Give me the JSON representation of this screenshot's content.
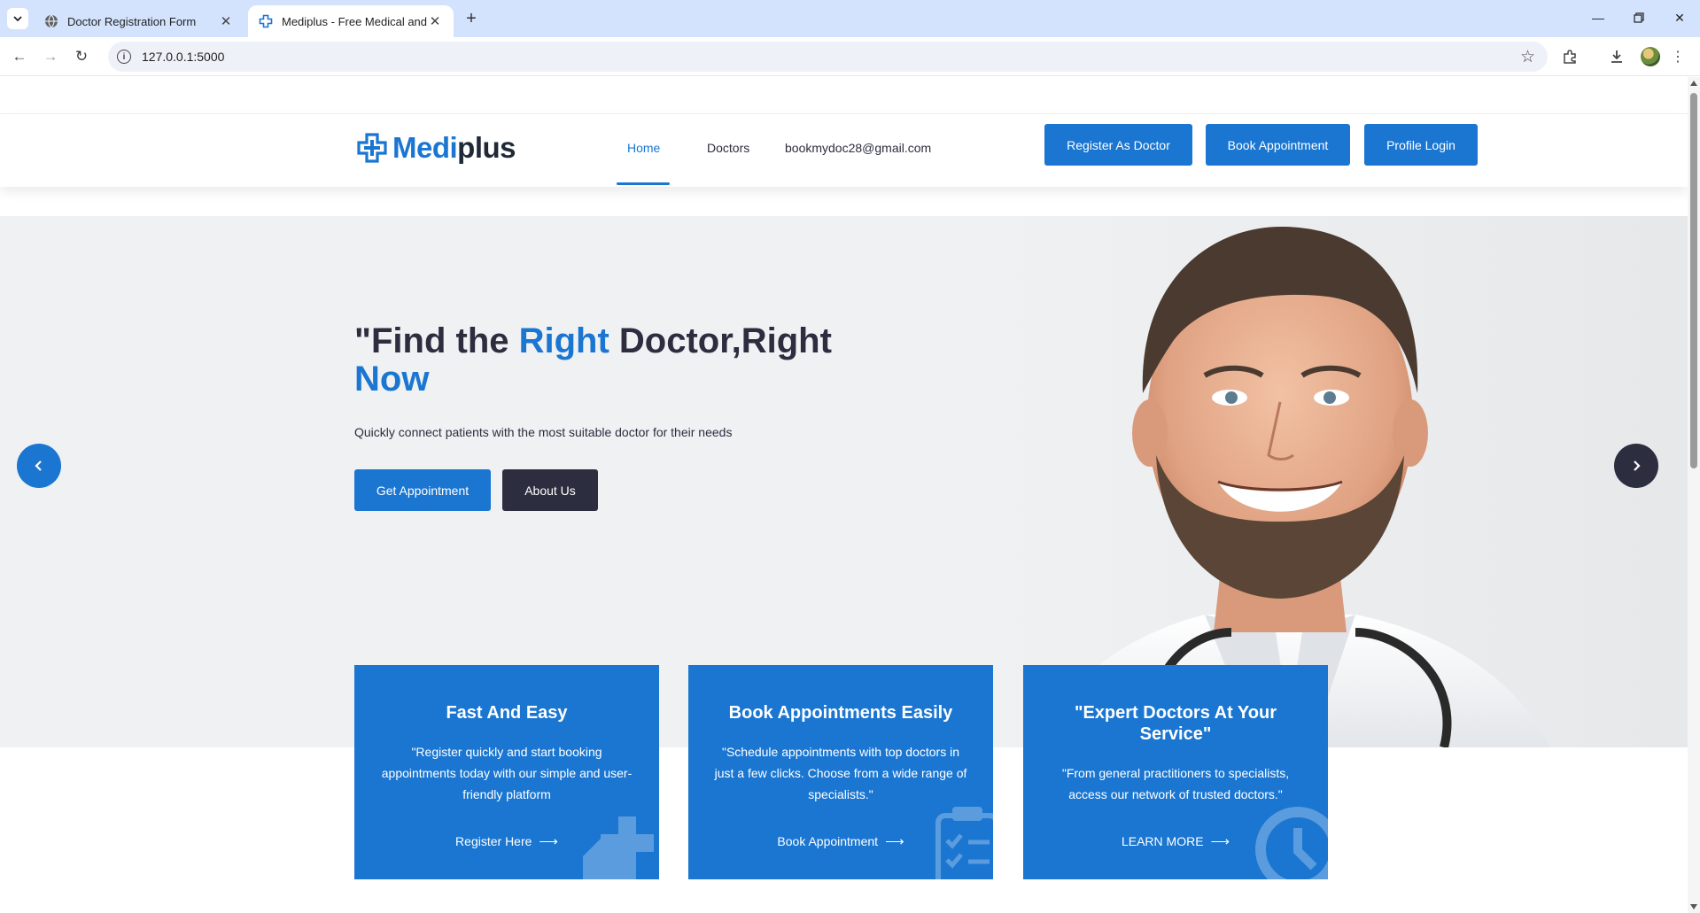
{
  "browser": {
    "tabs": [
      {
        "title": "Doctor Registration Form",
        "active": false
      },
      {
        "title": "Mediplus - Free Medical and Doctor",
        "active": true
      }
    ],
    "url": "127.0.0.1:5000"
  },
  "header": {
    "logo": {
      "part1": "Medi",
      "part2": "plus"
    },
    "nav": {
      "home": "Home",
      "doctors": "Doctors",
      "email": "bookmydoc28@gmail.com"
    },
    "buttons": {
      "register": "Register As Doctor",
      "book": "Book Appointment",
      "login": "Profile Login"
    }
  },
  "hero": {
    "title_parts": [
      "\"Find the ",
      "Right",
      " Doctor,Right ",
      "Now"
    ],
    "subtitle": "Quickly connect patients with the most suitable doctor for their needs",
    "primary_button": "Get Appointment",
    "secondary_button": "About Us"
  },
  "features": [
    {
      "title": "Fast And Easy",
      "text": "\"Register quickly and start booking appointments today with our simple and user-friendly platform",
      "link": "Register Here",
      "icon": "ambulance-icon"
    },
    {
      "title": "Book Appointments Easily",
      "text": "\"Schedule appointments with top doctors in just a few clicks. Choose from a wide range of specialists.\"",
      "link": "Book Appointment",
      "icon": "clipboard-icon"
    },
    {
      "title": "\"Expert Doctors At Your Service\"",
      "text": "\"From general practitioners to specialists, access our network of trusted doctors.\"",
      "link": "LEARN MORE",
      "icon": "clock-icon"
    }
  ],
  "colors": {
    "brand": "#1a76d1",
    "dark": "#2c2d3f",
    "hero_bg": "#eff1f3"
  }
}
